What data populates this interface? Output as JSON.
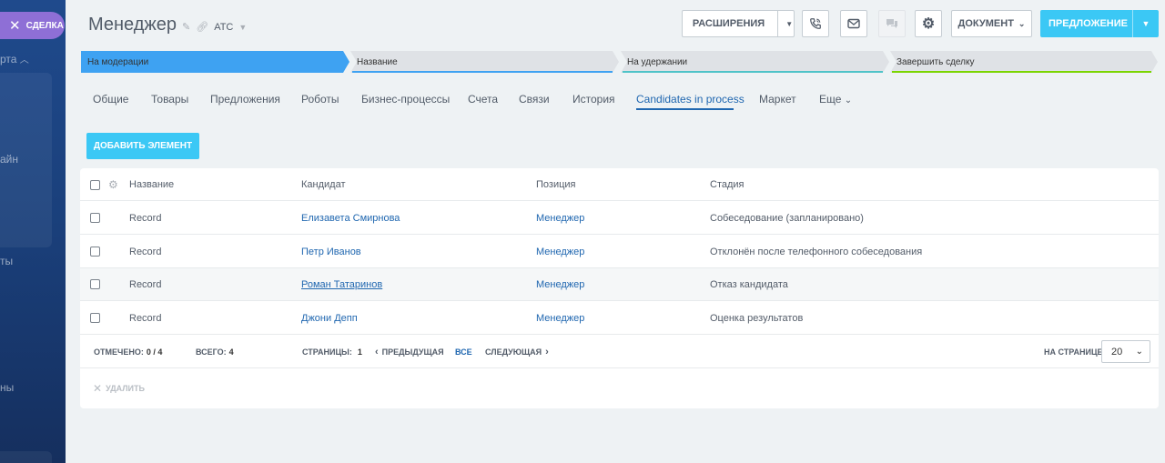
{
  "sidebar": {
    "pill_label": "СДЕЛКА",
    "fragments": [
      "рта",
      "айн",
      "ты",
      "ны"
    ]
  },
  "header": {
    "title": "Менеджер",
    "subtitle": "АТС"
  },
  "toolbar": {
    "extensions_label": "РАСШИРЕНИЯ",
    "document_label": "ДОКУМЕНТ",
    "primary_label": "ПРЕДЛОЖЕНИЕ",
    "icons": [
      "phone-icon",
      "mail-icon",
      "chat-icon",
      "gear-icon"
    ]
  },
  "stages": [
    {
      "label": "На модерации",
      "color": "#3ea2f2",
      "accent": "#3ea2f2",
      "active": true
    },
    {
      "label": "Название",
      "color": "#dfe2e6",
      "accent": "#3ea2f2",
      "active": false
    },
    {
      "label": "На удержании",
      "color": "#dfe2e6",
      "accent": "#4fc3c8",
      "active": false
    },
    {
      "label": "Завершить сделку",
      "color": "#dfe2e6",
      "accent": "#7bd500",
      "active": false
    }
  ],
  "tabs": [
    {
      "label": "Общие"
    },
    {
      "label": "Товары"
    },
    {
      "label": "Предложения"
    },
    {
      "label": "Роботы"
    },
    {
      "label": "Бизнес-процессы"
    },
    {
      "label": "Счета"
    },
    {
      "label": "Связи"
    },
    {
      "label": "История"
    },
    {
      "label": "Candidates in process",
      "active": true
    },
    {
      "label": "Маркет"
    },
    {
      "label": "Еще"
    }
  ],
  "add_button_label": "ДОБАВИТЬ ЭЛЕМЕНТ",
  "grid": {
    "columns": [
      "Название",
      "Кандидат",
      "Позиция",
      "Стадия"
    ],
    "rows": [
      {
        "name": "Record",
        "candidate": "Елизавета Смирнова",
        "position": "Менеджер",
        "stage": "Собеседование (запланировано)"
      },
      {
        "name": "Record",
        "candidate": "Петр Иванов",
        "position": "Менеджер",
        "stage": "Отклонён после телефонного собеседования"
      },
      {
        "name": "Record",
        "candidate": "Роман Татаринов",
        "position": "Менеджер",
        "stage": "Отказ кандидата"
      },
      {
        "name": "Record",
        "candidate": "Джони Депп",
        "position": "Менеджер",
        "stage": "Оценка результатов"
      }
    ]
  },
  "footer": {
    "marked_label": "ОТМЕЧЕНО:",
    "marked_value": "0 / 4",
    "total_label": "ВСЕГО:",
    "total_value": "4",
    "pages_label": "СТРАНИЦЫ:",
    "pages_value": "1",
    "prev_label": "ПРЕДЫДУЩАЯ",
    "all_label": "ВСЕ",
    "next_label": "СЛЕДУЮЩАЯ",
    "per_page_label": "НА СТРАНИЦЕ:",
    "per_page_value": "20",
    "delete_label": "УДАЛИТЬ"
  }
}
